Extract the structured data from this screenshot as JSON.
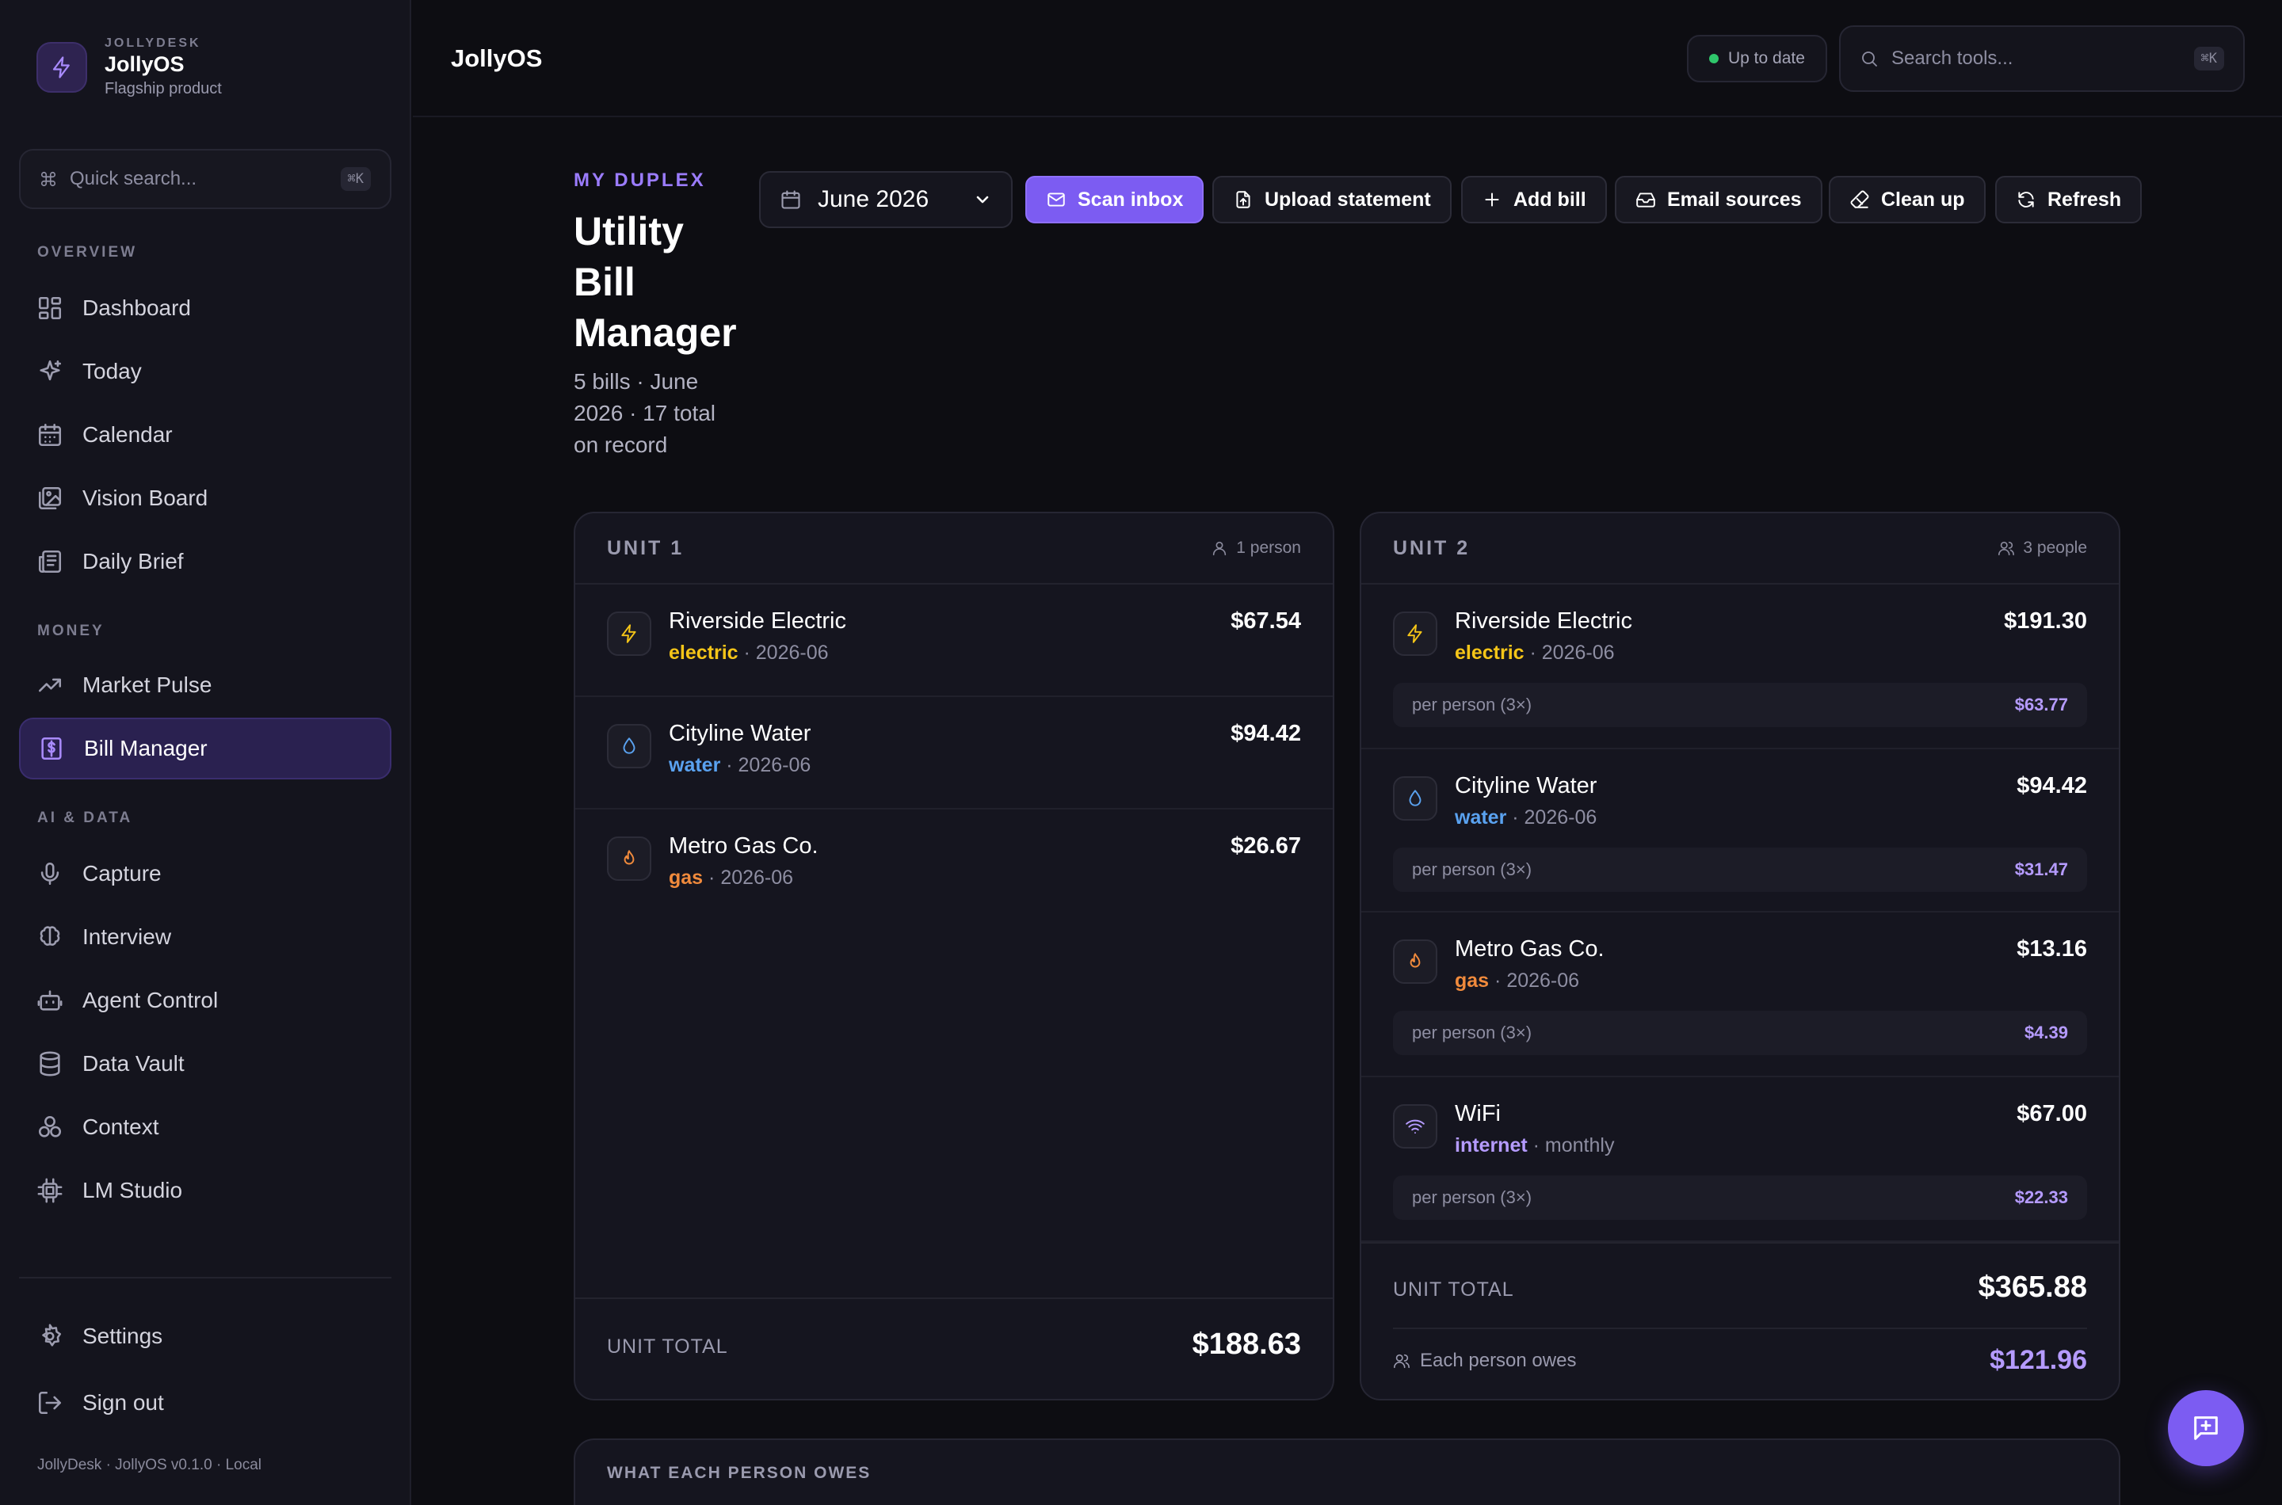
{
  "brand": {
    "kicker": "JOLLYDESK",
    "name": "JollyOS",
    "subtitle": "Flagship product"
  },
  "quick_search": {
    "placeholder": "Quick search...",
    "shortcut": "⌘K"
  },
  "sidebar": {
    "sections": {
      "overview": "OVERVIEW",
      "money": "MONEY",
      "ai_data": "AI & DATA"
    },
    "items": [
      {
        "label": "Dashboard",
        "icon": "grid-icon"
      },
      {
        "label": "Today",
        "icon": "sparkle-icon"
      },
      {
        "label": "Calendar",
        "icon": "calendar-icon"
      },
      {
        "label": "Vision Board",
        "icon": "image-board-icon"
      },
      {
        "label": "Daily Brief",
        "icon": "newspaper-icon"
      },
      {
        "label": "Market Pulse",
        "icon": "trend-icon"
      },
      {
        "label": "Bill Manager",
        "icon": "receipt-icon",
        "active": true
      },
      {
        "label": "Capture",
        "icon": "microphone-icon"
      },
      {
        "label": "Interview",
        "icon": "brain-icon"
      },
      {
        "label": "Agent Control",
        "icon": "bot-icon"
      },
      {
        "label": "Data Vault",
        "icon": "database-icon"
      },
      {
        "label": "Context",
        "icon": "circles-icon"
      },
      {
        "label": "LM Studio",
        "icon": "chip-icon"
      }
    ],
    "settings": "Settings",
    "sign_out": "Sign out",
    "footer": "JollyDesk · JollyOS v0.1.0 · Local"
  },
  "topbar": {
    "title": "JollyOS",
    "status": "Up to date",
    "search_placeholder": "Search tools...",
    "search_shortcut": "⌘K"
  },
  "page": {
    "kicker": "MY DUPLEX",
    "title": "Utility Bill Manager",
    "subtitle": "5 bills · June 2026 · 17 total on record",
    "month": "June 2026"
  },
  "toolbar": {
    "scan_inbox": "Scan inbox",
    "upload_statement": "Upload statement",
    "add_bill": "Add bill",
    "email_sources": "Email sources",
    "clean_up": "Clean up",
    "refresh": "Refresh"
  },
  "colors": {
    "accent": "#7c5cf2",
    "electric": "#f5c518",
    "water": "#5aa2f0",
    "gas": "#f08a3c",
    "internet": "#b59bff"
  },
  "units": [
    {
      "title": "UNIT 1",
      "people": "1 person",
      "bills": [
        {
          "name": "Riverside Electric",
          "type": "electric",
          "period": "2026-06",
          "amount": "$67.54"
        },
        {
          "name": "Cityline Water",
          "type": "water",
          "period": "2026-06",
          "amount": "$94.42"
        },
        {
          "name": "Metro Gas Co.",
          "type": "gas",
          "period": "2026-06",
          "amount": "$26.67"
        }
      ],
      "total_label": "UNIT TOTAL",
      "total": "$188.63"
    },
    {
      "title": "UNIT 2",
      "people": "3 people",
      "per_person_label": "per person (3×)",
      "bills": [
        {
          "name": "Riverside Electric",
          "type": "electric",
          "period": "2026-06",
          "amount": "$191.30",
          "per_person": "$63.77"
        },
        {
          "name": "Cityline Water",
          "type": "water",
          "period": "2026-06",
          "amount": "$94.42",
          "per_person": "$31.47"
        },
        {
          "name": "Metro Gas Co.",
          "type": "gas",
          "period": "2026-06",
          "amount": "$13.16",
          "per_person": "$4.39"
        },
        {
          "name": "WiFi",
          "type": "internet",
          "period": "monthly",
          "amount": "$67.00",
          "per_person": "$22.33"
        }
      ],
      "total_label": "UNIT TOTAL",
      "total": "$365.88",
      "each_owes_label": "Each person owes",
      "each_owes": "$121.96"
    }
  ],
  "owes_section": {
    "title": "WHAT EACH PERSON OWES"
  }
}
